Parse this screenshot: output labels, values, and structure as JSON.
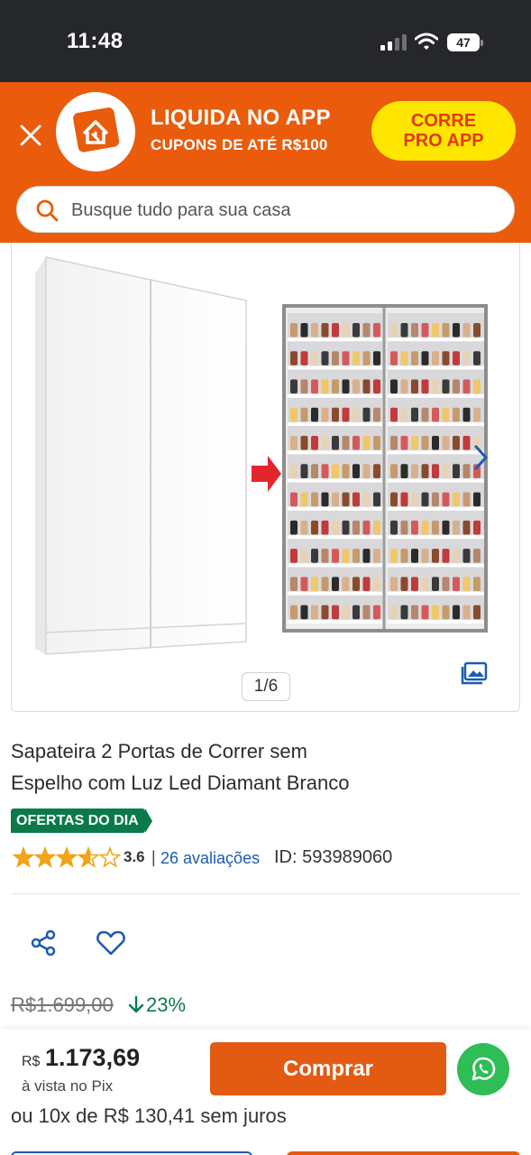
{
  "status_bar": {
    "time": "11:48",
    "battery": "47",
    "icons": [
      "cellular-signal-icon",
      "wifi-icon",
      "battery-icon"
    ]
  },
  "banner": {
    "title": "LIQUIDA NO APP",
    "subtitle": "CUPONS DE ATÉ R$100",
    "cta_line1": "CORRE",
    "cta_line2": "PRO APP",
    "icons": [
      "close-icon",
      "home-cart-logo-icon"
    ],
    "colors": {
      "background": "#ea5b0c",
      "cta": "#ffe600",
      "cta_text": "#e4380a"
    }
  },
  "search": {
    "placeholder": "Busque tudo para sua casa",
    "icon": "search-icon"
  },
  "gallery": {
    "indicator": "1/6",
    "icons": [
      "chevron-right-icon",
      "gallery-icon"
    ]
  },
  "product": {
    "title_line1": "Sapateira 2 Portas de Correr sem",
    "title_line2": "Espelho com Luz Led Diamant Branco",
    "badge": "OFERTAS DO DIA",
    "rating": "3.6",
    "rating_fraction": 0.72,
    "separator": "|",
    "reviews": "26 avaliações",
    "id_label": "ID: 593989060"
  },
  "actions": {
    "icons": [
      "share-icon",
      "heart-icon"
    ]
  },
  "pricing": {
    "old_price": "R$1.699,00",
    "discount": "23%",
    "currency": "R$",
    "price": "1.173,69",
    "price_note": "à vista no Pix",
    "installments": "ou 10x de R$ 130,41 sem juros"
  },
  "buy": {
    "label": "Comprar",
    "whatsapp_icon": "whatsapp-icon"
  },
  "colors": {
    "accent": "#e35b12",
    "green": "#0b7a4b",
    "link": "#1b5bb2",
    "whatsapp": "#2fbd55",
    "star": "#f0a418"
  }
}
